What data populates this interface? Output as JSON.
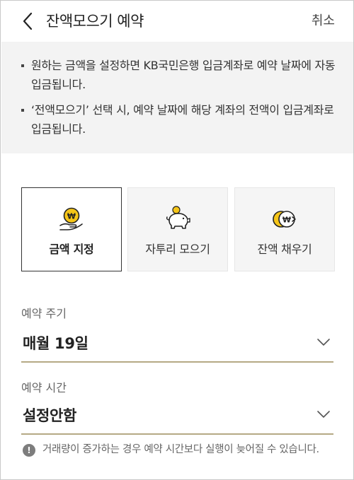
{
  "header": {
    "title": "잔액모으기 예약",
    "cancel_label": "취소"
  },
  "info": {
    "items": [
      "원하는 금액을 설정하면 KB국민은행 입금계좌로 예약 날짜에 자동 입금됩니다.",
      "‘전액모으기’ 선택 시, 예약 날짜에 해당 계좌의 전액이 입금계좌로 입금됩니다."
    ]
  },
  "options": {
    "items": [
      {
        "label": "금액 지정",
        "icon": "coin-hand-icon",
        "selected": true
      },
      {
        "label": "자투리 모으기",
        "icon": "piggy-bank-icon",
        "selected": false
      },
      {
        "label": "잔액 채우기",
        "icon": "coin-fill-icon",
        "selected": false
      }
    ]
  },
  "cycle": {
    "label": "예약 주기",
    "value": "매월 19일"
  },
  "time": {
    "label": "예약 시간",
    "value": "설정안함"
  },
  "notice": {
    "icon": "exclamation-icon",
    "text": "거래량이 증가하는 경우 예약 시간보다 실행이 늦어질 수 있습니다."
  },
  "colors": {
    "accent_gold": "#f5c518",
    "underline": "#b5a984",
    "info_bg": "#f3f3f3"
  }
}
